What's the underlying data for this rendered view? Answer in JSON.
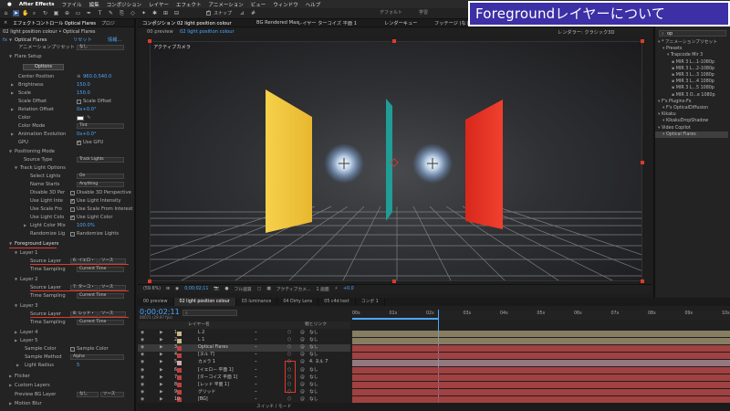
{
  "banner": {
    "title": "Foregroundレイヤーについて"
  },
  "menubar": {
    "app": "After Effects",
    "items": [
      "ファイル",
      "編集",
      "コンポジション",
      "レイヤー",
      "エフェクト",
      "アニメーション",
      "ビュー",
      "ウィンドウ",
      "ヘルプ"
    ]
  },
  "toolbar": {
    "snap_label": "スナップ",
    "workspaces": [
      "デフォルト",
      "学習"
    ]
  },
  "left_panel": {
    "breadcrumb": "02 light position colour • Optical Flares",
    "tabs": [
      "エフェクトコントロール Optical Flares",
      "プロジ"
    ],
    "effect_name": "Optical Flares",
    "effect_reset": "リセット",
    "effect_about": "情報...",
    "animation_preset_label": "アニメーションプリセット",
    "animation_preset_value": "なし",
    "flare_setup": "Flare Setup",
    "options_button": "Options",
    "center_position_label": "Center Position",
    "center_position_value": "960.0,540.0",
    "brightness_label": "Brightness",
    "brightness_value": "150.0",
    "scale_label": "Scale",
    "scale_value": "150.0",
    "scale_offset_label": "Scale Offset",
    "scale_offset_check": "Scale Offset",
    "rotation_offset_label": "Rotation Offset",
    "rotation_offset_value": "0x+0.0°",
    "color_label": "Color",
    "color_mode_label": "Color Mode",
    "color_mode_value": "Tint",
    "animation_evolution_label": "Animation Evolution",
    "animation_evolution_value": "0x+0.0°",
    "gpu_label": "GPU",
    "gpu_check": "Use GPU",
    "positioning_mode": "Positioning Mode",
    "source_type_label": "Source Type",
    "source_type_value": "Track Lights",
    "track_light_options": "Track Light Options",
    "select_lights_label": "Select Lights",
    "select_lights_value": "On",
    "name_starts_label": "Name Starts",
    "name_starts_value": "Anything",
    "disable3d_label": "Disable 3D Per",
    "disable3d_check": "Disable 3D Perspective",
    "use_light_int_label": "Use Light Inte",
    "use_light_int_check": "Use Light Intensity",
    "use_scale_label": "Use Scale Fro",
    "use_scale_check": "Use Scale From Interest",
    "use_light_col_label": "Use Light Colo",
    "use_light_col_check": "Use Light Color",
    "light_color_mix_label": "Light Color Mix",
    "light_color_mix_value": "100.0%",
    "randomize_label": "Randomize Lig",
    "randomize_check": "Randomize Lights",
    "foreground_layers": "Foreground Layers",
    "layer1": "Layer 1",
    "layer2": "Layer 2",
    "layer3": "Layer 3",
    "layer4": "Layer 4",
    "layer5": "Layer 5",
    "source_layer_label": "Source Layer",
    "time_sampling_label": "Time Sampling",
    "time_sampling_value": "Current Time",
    "layer1_source": "6. イエロ・",
    "layer2_source": "7. ターコ・",
    "layer3_source": "8. レッド・",
    "source_suffix": "ソース",
    "sample_color_label": "Sample Color",
    "sample_color_check": "Sample Color",
    "sample_method_label": "Sample Method",
    "sample_method_value": "Alpha",
    "light_radius_label": "Light Radius",
    "light_radius_value": "5",
    "flicker": "Flicker",
    "custom_layers": "Custom Layers",
    "preview_bg_label": "Preview BG Layer",
    "preview_bg_value": "なし",
    "preview_bg_suffix": "ソース",
    "motion_blur": "Motion Blur"
  },
  "viewer": {
    "tabs": [
      "コンポジション 02 light position colour",
      "レイヤー ターコイズ 平面 1",
      "レンダーキュー",
      "フッテージ (なし)"
    ],
    "subtabs": [
      "00 preview",
      "02 light position colour"
    ],
    "renderer": "レンダラー: クラシック3D",
    "renderer_tab": "BG Rendered Max",
    "camera_label": "アクティブカメラ",
    "zoom": "(59.6%)",
    "timecode": "0;00;02;11",
    "quality": "フル画質",
    "view": "アクティブカメ...",
    "views": "1 画面",
    "exposure": "+0.0"
  },
  "right_panel": {
    "search": "op",
    "items": [
      {
        "label": "* アニメーションプリセット",
        "indent": 0
      },
      {
        "label": "Presets",
        "indent": 1
      },
      {
        "label": "Trapcode Mir 3",
        "indent": 2
      },
      {
        "label": "MIR 3 L...1-1080p",
        "indent": 3
      },
      {
        "label": "MIR 3 L...2-1080p",
        "indent": 3
      },
      {
        "label": "MIR 3 L...3 1080p",
        "indent": 3
      },
      {
        "label": "MIR 3 L...4 1080p",
        "indent": 3
      },
      {
        "label": "MIR 3 L...5 1080p",
        "indent": 3
      },
      {
        "label": "MIR 3 O...e 1080p",
        "indent": 3
      },
      {
        "label": "F's Plugins-Fx",
        "indent": 0
      },
      {
        "label": "F's OpticalDiffusion",
        "indent": 1
      },
      {
        "label": "Kikaku",
        "indent": 0
      },
      {
        "label": "KikakuDropShadow",
        "indent": 1
      },
      {
        "label": "Video Copilot",
        "indent": 0
      },
      {
        "label": "Optical Flares",
        "indent": 1
      }
    ]
  },
  "timeline": {
    "tabs": [
      "00 preview",
      "02 light position colour",
      "03 luminance",
      "04 Dirty Lens",
      "05 c4d text",
      "コンポ 1"
    ],
    "timecode": "0;00;02;11",
    "timecode_sub": "00071 (29.97 fps)",
    "col_layer_name": "レイヤー名",
    "col_parent": "親とリンク",
    "ruler": [
      "00s",
      "01s",
      "02s",
      "03s",
      "04s",
      "05s",
      "06s",
      "07s",
      "08s",
      "09s",
      "10s"
    ],
    "footer": "スイッチ / モード",
    "layers": [
      {
        "num": "1",
        "name": "L 2",
        "parent": "なし",
        "color": "#c8b88a"
      },
      {
        "num": "2",
        "name": "L 1",
        "parent": "なし",
        "color": "#c8b88a"
      },
      {
        "num": "3",
        "name": "Optical Flares",
        "parent": "なし",
        "color": "#c04040"
      },
      {
        "num": "4",
        "name": "[ヌル 7]",
        "parent": "なし",
        "color": "#c04040"
      },
      {
        "num": "5",
        "name": "カメラ 1",
        "parent": "4. ヌル 7",
        "color": "#d8a8b0"
      },
      {
        "num": "6",
        "name": "[イエロー 平面 1]",
        "parent": "なし",
        "color": "#c04040"
      },
      {
        "num": "7",
        "name": "[ターコイズ 平面 1]",
        "parent": "なし",
        "color": "#c04040"
      },
      {
        "num": "8",
        "name": "[レッド 平面 1]",
        "parent": "なし",
        "color": "#c04040"
      },
      {
        "num": "9",
        "name": "グリッド",
        "parent": "なし",
        "color": "#c04040"
      },
      {
        "num": "10",
        "name": "[BG]",
        "parent": "なし",
        "color": "#c04040"
      }
    ]
  },
  "colors": {
    "accent_red": "#e03a2a",
    "accent_blue": "#4aa8ff",
    "banner_bg": "#3d2fa6",
    "yellow_panel": "#f2c640",
    "red_panel": "#e83a2a",
    "teal_panel": "#1f9d96"
  }
}
